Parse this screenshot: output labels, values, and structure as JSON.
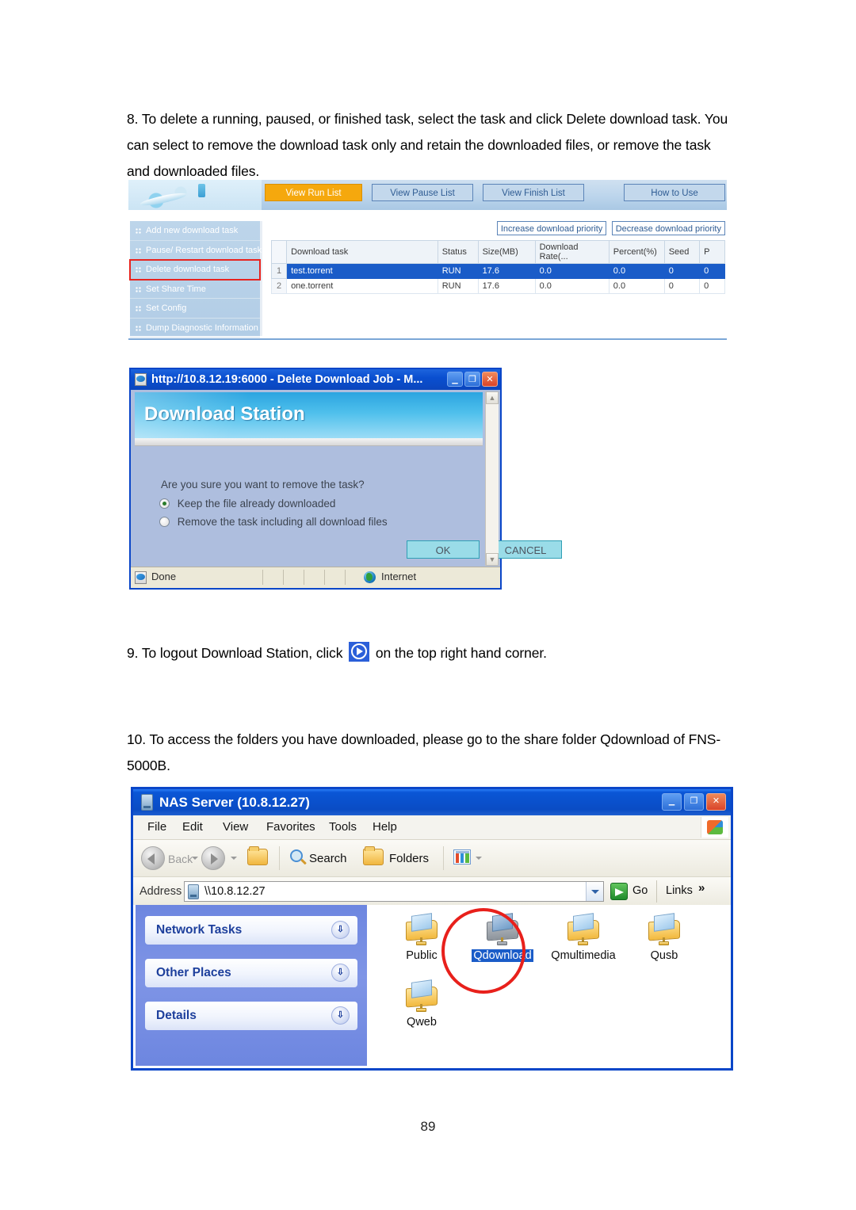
{
  "document": {
    "paragraph_8": "8. To delete a running, paused, or finished task, select the task and click Delete download task.  You can select to remove the download task only and retain the downloaded files, or remove the task and downloaded files.",
    "paragraph_9_before": "9. To logout Download Station, click",
    "paragraph_9_after": "on the top right hand corner.",
    "paragraph_10": "10. To access the folders you have downloaded, please go to the share folder Qdownload of FNS-5000B.",
    "page_number": "89"
  },
  "download_station": {
    "tabs": [
      {
        "label": "View Run List",
        "active": true
      },
      {
        "label": "View Pause List",
        "active": false
      },
      {
        "label": "View Finish List",
        "active": false
      },
      {
        "label": "How to Use",
        "active": false
      }
    ],
    "menu": [
      {
        "label": "Add new download task",
        "highlighted": false
      },
      {
        "label": "Pause/ Restart download task",
        "highlighted": false
      },
      {
        "label": "Delete download task",
        "highlighted": true
      },
      {
        "label": "Set Share Time",
        "highlighted": false
      },
      {
        "label": "Set Config",
        "highlighted": false
      },
      {
        "label": "Dump Diagnostic Information",
        "highlighted": false
      }
    ],
    "priority_buttons": [
      "Increase download priority",
      "Decrease download priority"
    ],
    "table": {
      "columns": [
        "",
        "Download task",
        "Status",
        "Size(MB)",
        "Download Rate(...",
        "Percent(%)",
        "Seed",
        "P"
      ],
      "rows": [
        {
          "index": "1",
          "task": "test.torrent",
          "status": "RUN",
          "size": "17.6",
          "rate": "0.0",
          "percent": "0.0",
          "seed": "0",
          "p": "0",
          "selected": true
        },
        {
          "index": "2",
          "task": "one.torrent",
          "status": "RUN",
          "size": "17.6",
          "rate": "0.0",
          "percent": "0.0",
          "seed": "0",
          "p": "0",
          "selected": false
        }
      ]
    }
  },
  "delete_dialog": {
    "window_title": "http://10.8.12.19:6000 - Delete Download Job - M...",
    "header": "Download Station",
    "question": "Are you sure you want to remove the task?",
    "options": [
      {
        "label": "Keep the file already downloaded",
        "selected": true
      },
      {
        "label": "Remove the task including all download files",
        "selected": false
      }
    ],
    "buttons": {
      "ok": "OK",
      "cancel": "CANCEL"
    },
    "status": {
      "left": "Done",
      "zone": "Internet"
    },
    "window_controls": {
      "minimize": "_",
      "maximize": "❐",
      "close": "✕"
    }
  },
  "explorer": {
    "window_title": "NAS Server (10.8.12.27)",
    "menus": [
      "File",
      "Edit",
      "View",
      "Favorites",
      "Tools",
      "Help"
    ],
    "toolbar": {
      "back": "Back",
      "search": "Search",
      "folders": "Folders"
    },
    "address": {
      "label": "Address",
      "value": "\\\\10.8.12.27",
      "go": "Go",
      "links": "Links",
      "links_chevron": "»"
    },
    "sidebar_panels": [
      {
        "title": "Network Tasks",
        "chevron": "»"
      },
      {
        "title": "Other Places",
        "chevron": "»"
      },
      {
        "title": "Details",
        "chevron": "»"
      }
    ],
    "files": [
      {
        "name": "Public",
        "selected": false
      },
      {
        "name": "Qdownload",
        "selected": true
      },
      {
        "name": "Qmultimedia",
        "selected": false
      },
      {
        "name": "Qusb",
        "selected": false
      },
      {
        "name": "Qweb",
        "selected": false
      }
    ],
    "window_controls": {
      "minimize": "_",
      "maximize": "❐",
      "close": "✕"
    }
  },
  "colors": {
    "accent_orange": "#f5a80d",
    "selection_blue": "#1a5cc8",
    "annotation_red": "#e8201b",
    "title_blue": "#0a4cc4"
  }
}
